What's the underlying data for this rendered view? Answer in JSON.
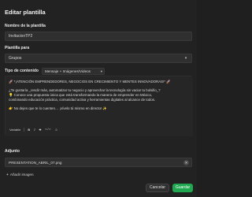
{
  "dialog": {
    "title": "Editar plantilla",
    "name_label": "Nombre de la plantilla",
    "name_value": "InvitacionTP2",
    "for_label": "Plantilla para",
    "for_value": "Grupos",
    "type_label": "Tipo de contenido",
    "type_value": "Mensaje + Imágenes/Videos",
    "message_lines": [
      "🚀 *¡ATENCIÓN EMPRENDEDORES, NEGOCIOS EN CRECIMIENTO Y MENTES INNOVADORAS!* 🚀",
      "¿Te gustaría _rendir más, automatizar tu negocio y aprovechar la tecnología sin vaciar tu bolsillo_?",
      "💡 Conoce una propuesta única que está transformando la manera de emprender en México,",
      "combinando educación práctica, comunidad activa y herramientas digitales al alcance de todos.",
      "👉 No dejes que te lo cuenten… ¡vívelo tú mismo en directo! ✨"
    ],
    "toolbar": {
      "variable": "Variable",
      "bold": "B",
      "italic": "I",
      "strike": "S",
      "mono": "</>",
      "emoji": "☺"
    },
    "attachment_label": "Adjunto",
    "attachment_file": "PRESENTATION_ABRIL_07.png",
    "add_image_label": "Añadir imagen",
    "cancel_label": "Cancelar",
    "save_label": "Guardar"
  },
  "colors": {
    "background": "#222222",
    "field": "#2f2f2f",
    "save_button": "#1fa84f"
  }
}
